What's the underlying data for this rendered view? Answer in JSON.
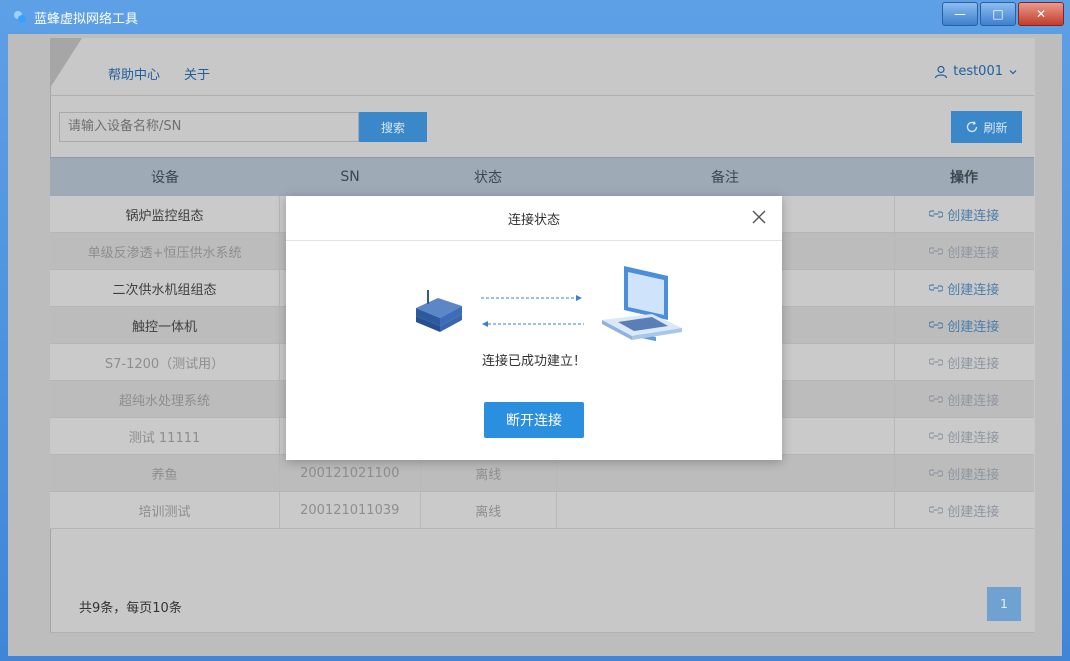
{
  "window": {
    "title": "蓝蜂虚拟网络工具",
    "minimize": "—",
    "maximize": "□",
    "close": "✕"
  },
  "nav": {
    "help": "帮助中心",
    "about": "关于",
    "user": "test001"
  },
  "search": {
    "placeholder": "请输入设备名称/SN",
    "button": "搜索",
    "refresh": "刷新"
  },
  "table": {
    "headers": [
      "设备",
      "SN",
      "状态",
      "备注",
      "操作"
    ],
    "rows": [
      {
        "device": "锅炉监控组态",
        "sn": "",
        "status": "",
        "note": "",
        "action": "创建连接",
        "online": true
      },
      {
        "device": "单级反渗透+恒压供水系统",
        "sn": "",
        "status": "",
        "note": "",
        "action": "创建连接",
        "online": false
      },
      {
        "device": "二次供水机组组态",
        "sn": "",
        "status": "",
        "note": "",
        "action": "创建连接",
        "online": true
      },
      {
        "device": "触控一体机",
        "sn": "",
        "status": "",
        "note": "",
        "action": "创建连接",
        "online": true
      },
      {
        "device": "S7-1200（测试用）",
        "sn": "",
        "status": "",
        "note": "",
        "action": "创建连接",
        "online": false
      },
      {
        "device": "超纯水处理系统",
        "sn": "",
        "status": "",
        "note": "",
        "action": "创建连接",
        "online": false
      },
      {
        "device": "测试 11111",
        "sn": "",
        "status": "",
        "note": "",
        "action": "创建连接",
        "online": false
      },
      {
        "device": "养鱼",
        "sn": "200121021100",
        "status": "离线",
        "note": "",
        "action": "创建连接",
        "online": false
      },
      {
        "device": "培训测试",
        "sn": "200121011039",
        "status": "离线",
        "note": "",
        "action": "创建连接",
        "online": false
      }
    ]
  },
  "footer": {
    "summary": "共9条，每页10条",
    "page": "1"
  },
  "modal": {
    "title": "连接状态",
    "message": "连接已成功建立！",
    "button": "断开连接"
  }
}
